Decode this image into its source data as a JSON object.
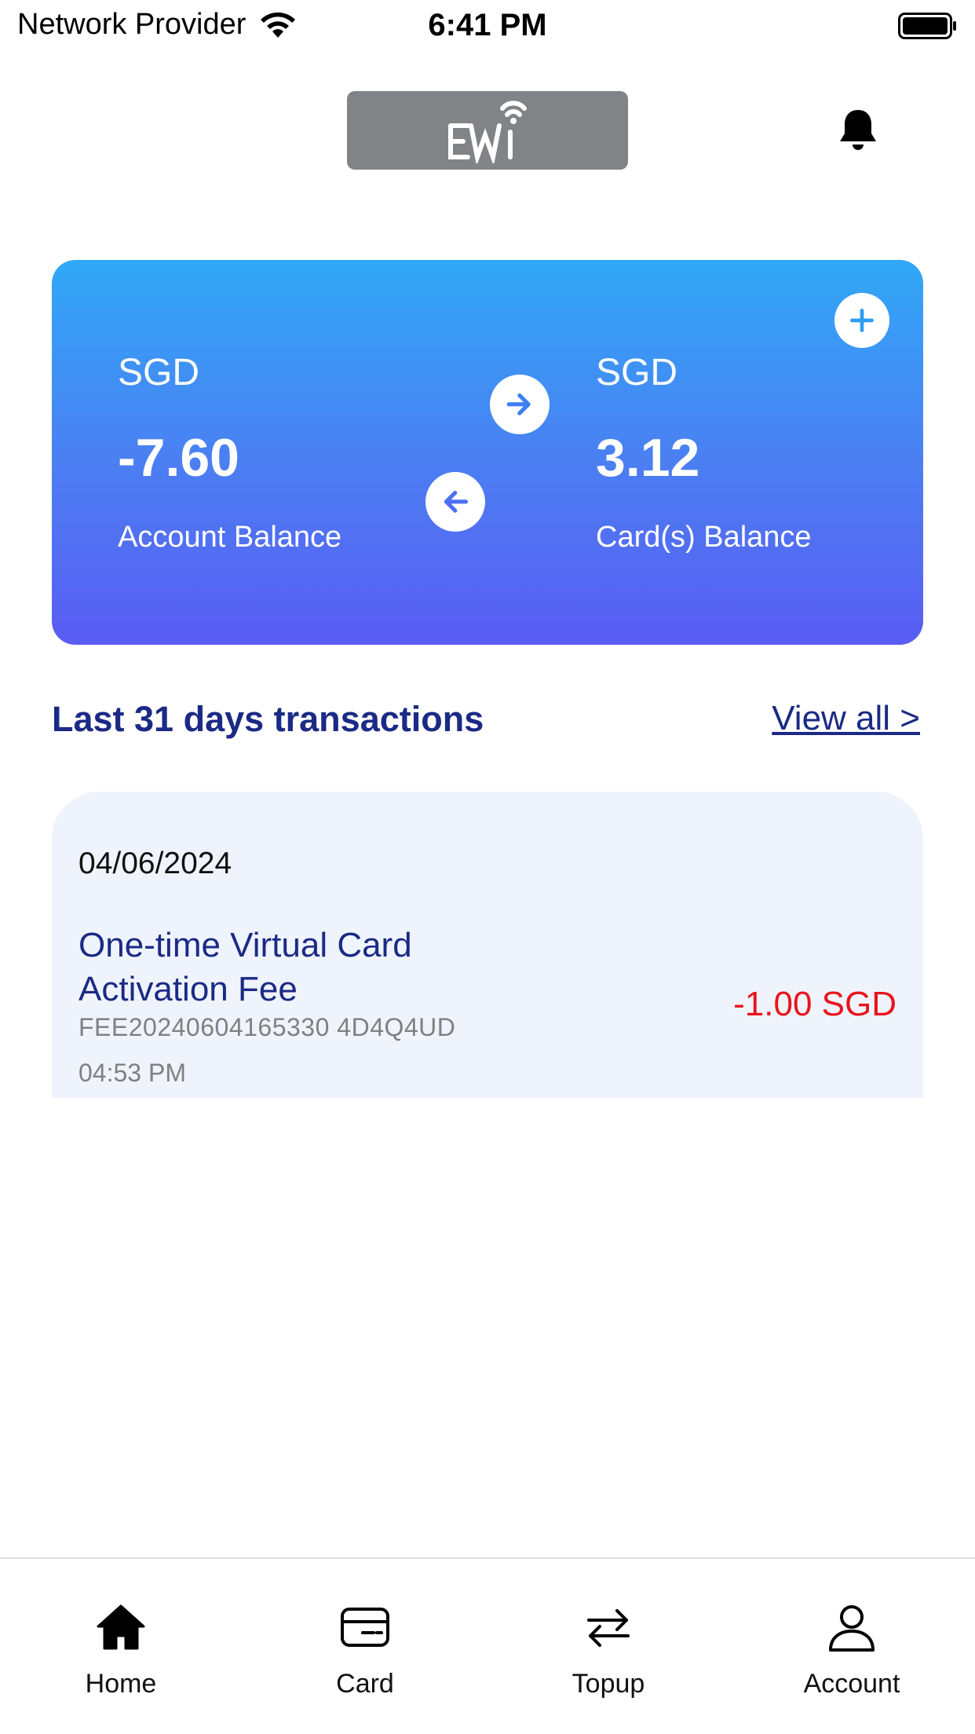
{
  "status_bar": {
    "carrier": "Network Provider",
    "time": "6:41 PM",
    "icons": [
      "wifi-icon",
      "battery-icon"
    ]
  },
  "header": {
    "logo_icon": "app-logo",
    "notification_icon": "bell-icon"
  },
  "balance_card": {
    "account": {
      "currency": "SGD",
      "amount": "-7.60",
      "label": "Account Balance"
    },
    "card": {
      "currency": "SGD",
      "amount": "3.12",
      "label": "Card(s) Balance"
    },
    "icons": [
      "arrow-right-icon",
      "arrow-left-icon",
      "plus-icon"
    ],
    "gradient_colors": [
      "#31a8f7",
      "#5a5cf3"
    ]
  },
  "transactions": {
    "title": "Last 31 days transactions",
    "view_all": "View all >",
    "items": [
      {
        "date": "04/06/2024",
        "description": "One-time Virtual Card Activation Fee",
        "reference": "FEE20240604165330 4D4Q4UD",
        "time": "04:53 PM",
        "amount": "-1.00 SGD"
      }
    ]
  },
  "bottom_nav": {
    "items": [
      {
        "label": "Home",
        "icon": "home-icon"
      },
      {
        "label": "Card",
        "icon": "card-icon"
      },
      {
        "label": "Topup",
        "icon": "transfer-arrows-icon"
      },
      {
        "label": "Account",
        "icon": "user-icon"
      }
    ]
  },
  "colors": {
    "primary_text": "#1b2a85",
    "negative": "#e8141b",
    "transaction_bg": "#eff3fc"
  }
}
